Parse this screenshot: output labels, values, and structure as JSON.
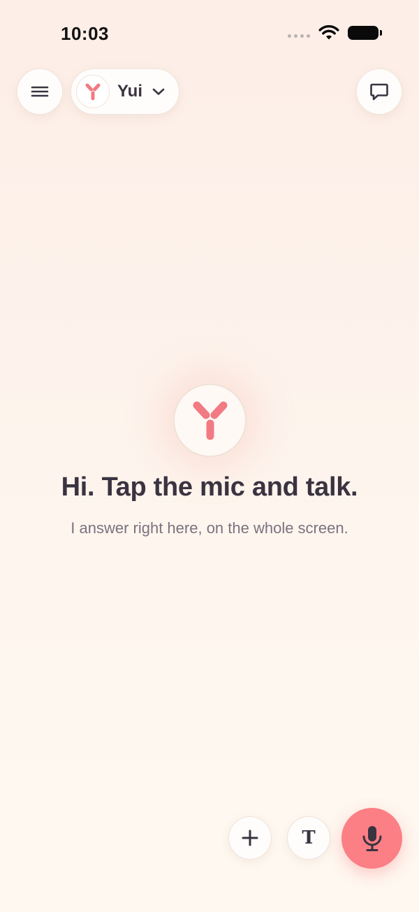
{
  "status_bar": {
    "time": "10:03"
  },
  "header": {
    "assistant_name": "Yui"
  },
  "hero": {
    "title": "Hi. Tap the mic and talk.",
    "subtitle": "I answer right here, on the whole screen."
  },
  "actions": {
    "text_mode_glyph": "T"
  },
  "icons": {
    "menu": "menu-icon",
    "chevron": "chevron-down-icon",
    "chat": "chat-bubble-icon",
    "add": "plus-icon",
    "mic": "microphone-icon",
    "logo": "yui-logo-icon"
  },
  "colors": {
    "accent": "#fb7f85",
    "logo_pink": "#f27a82",
    "text_dark": "#3a3340",
    "text_muted": "#7a7380"
  }
}
